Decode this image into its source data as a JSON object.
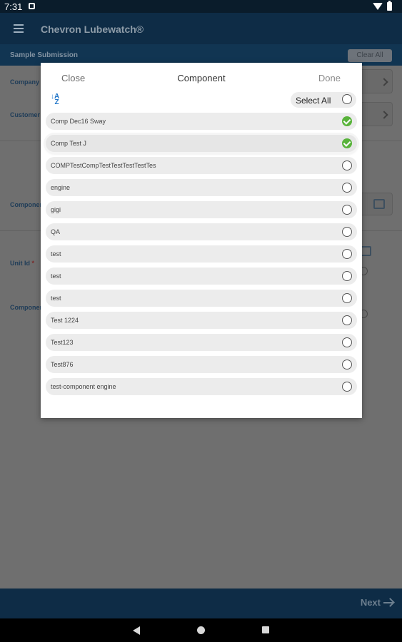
{
  "status_bar": {
    "time": "7:31"
  },
  "app": {
    "title": "Chevron Lubewatch®"
  },
  "section": {
    "title": "Sample Submission",
    "clear_all": "Clear All"
  },
  "background_form": {
    "company_label": "Company",
    "customer_label": "Customer",
    "component_label": "Component",
    "unit_id_label": "Unit Id",
    "unit_id_required": "*",
    "component_label_2": "Component"
  },
  "bottom": {
    "next_label": "Next"
  },
  "dialog": {
    "title": "Component",
    "close_label": "Close",
    "done_label": "Done",
    "select_all_label": "Select All",
    "select_all_checked": false,
    "items": [
      {
        "name": "Comp Dec16 Sway",
        "checked": true
      },
      {
        "name": "Comp Test J",
        "checked": true
      },
      {
        "name": "COMPTestCompTestTestTestTestTes",
        "checked": false
      },
      {
        "name": "engine",
        "checked": false
      },
      {
        "name": "gigi",
        "checked": false
      },
      {
        "name": "QA",
        "checked": false
      },
      {
        "name": "test",
        "checked": false
      },
      {
        "name": "test",
        "checked": false
      },
      {
        "name": "test",
        "checked": false
      },
      {
        "name": "Test 1224",
        "checked": false
      },
      {
        "name": "Test123",
        "checked": false
      },
      {
        "name": "Test876",
        "checked": false
      },
      {
        "name": "test-component engine",
        "checked": false
      }
    ]
  },
  "colors": {
    "primary_dark": "#0e2c46",
    "accent_blue": "#1e74c8",
    "check_green": "#58b33a"
  }
}
